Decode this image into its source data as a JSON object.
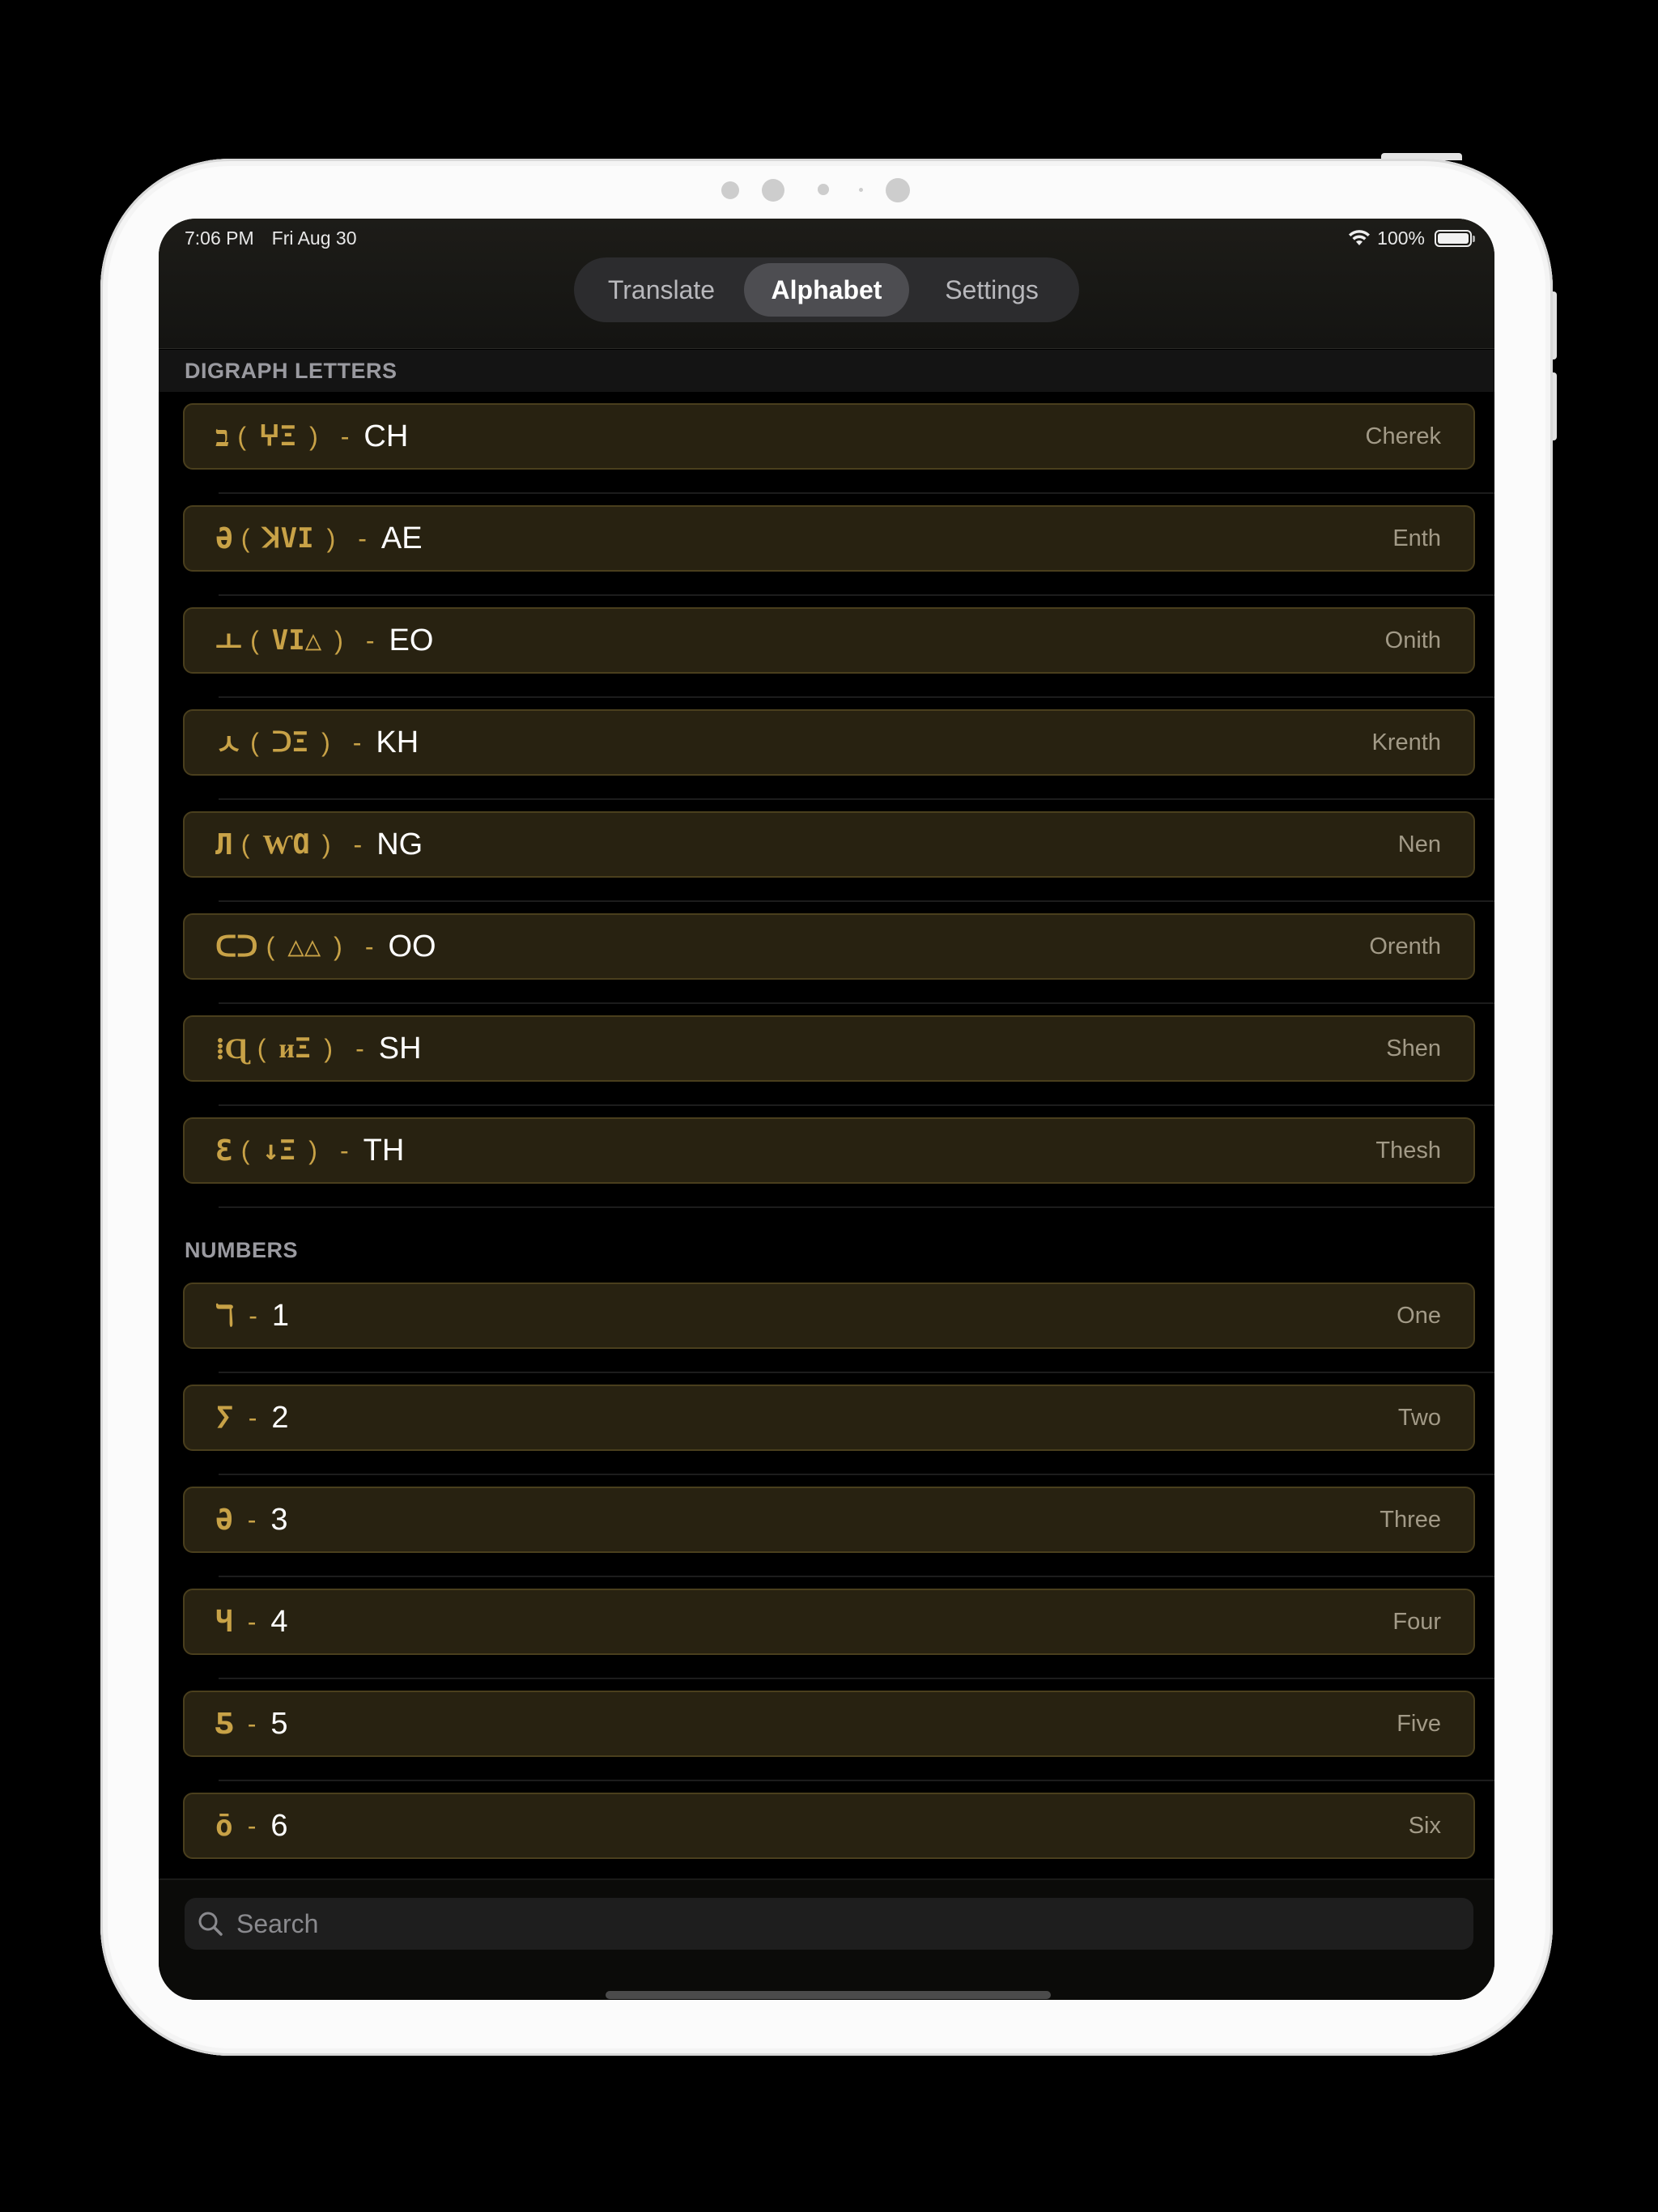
{
  "status": {
    "time": "7:06 PM",
    "date": "Fri Aug 30",
    "battery": "100%"
  },
  "tabs": [
    {
      "label": "Translate",
      "active": false
    },
    {
      "label": "Alphabet",
      "active": true
    },
    {
      "label": "Settings",
      "active": false
    }
  ],
  "sections": {
    "digraph": {
      "title": "DIGRAPH LETTERS",
      "rows": [
        {
          "glyph": "ב",
          "glyph_pair": "ⵖΞ",
          "latin": "CH",
          "name": "Cherek"
        },
        {
          "glyph": "Ә",
          "glyph_pair": "ꓘVI",
          "latin": "AE",
          "name": "Enth"
        },
        {
          "glyph": "ㅗ",
          "glyph_pair": "VI△",
          "latin": "EO",
          "name": "Onith"
        },
        {
          "glyph": "ㅅ",
          "glyph_pair": "ᑐΞ",
          "latin": "KH",
          "name": "Krenth"
        },
        {
          "glyph": "Л",
          "glyph_pair": "ⱲⱭ",
          "latin": "NG",
          "name": "Nen"
        },
        {
          "glyph": "ᑕᑐ",
          "glyph_pair": "△△",
          "latin": "OO",
          "name": "Orenth"
        },
        {
          "glyph": "⁞Ɋ",
          "glyph_pair": "ᴎΞ",
          "latin": "SH",
          "name": "Shen"
        },
        {
          "glyph": "Ɛ",
          "glyph_pair": "↓Ξ",
          "latin": "TH",
          "name": "Thesh"
        }
      ]
    },
    "numbers": {
      "title": "NUMBERS",
      "rows": [
        {
          "glyph": "ℸ",
          "latin": "1",
          "name": "One"
        },
        {
          "glyph": "ⵢ",
          "latin": "2",
          "name": "Two"
        },
        {
          "glyph": "Ә",
          "latin": "3",
          "name": "Three"
        },
        {
          "glyph": "Ч",
          "latin": "4",
          "name": "Four"
        },
        {
          "glyph": "Ƽ",
          "latin": "5",
          "name": "Five"
        },
        {
          "glyph": "ō",
          "latin": "6",
          "name": "Six"
        }
      ]
    }
  },
  "search": {
    "placeholder": "Search"
  },
  "colors": {
    "accent": "#c8a247",
    "card_bg": "#282211",
    "card_border": "#4a3f1d"
  }
}
